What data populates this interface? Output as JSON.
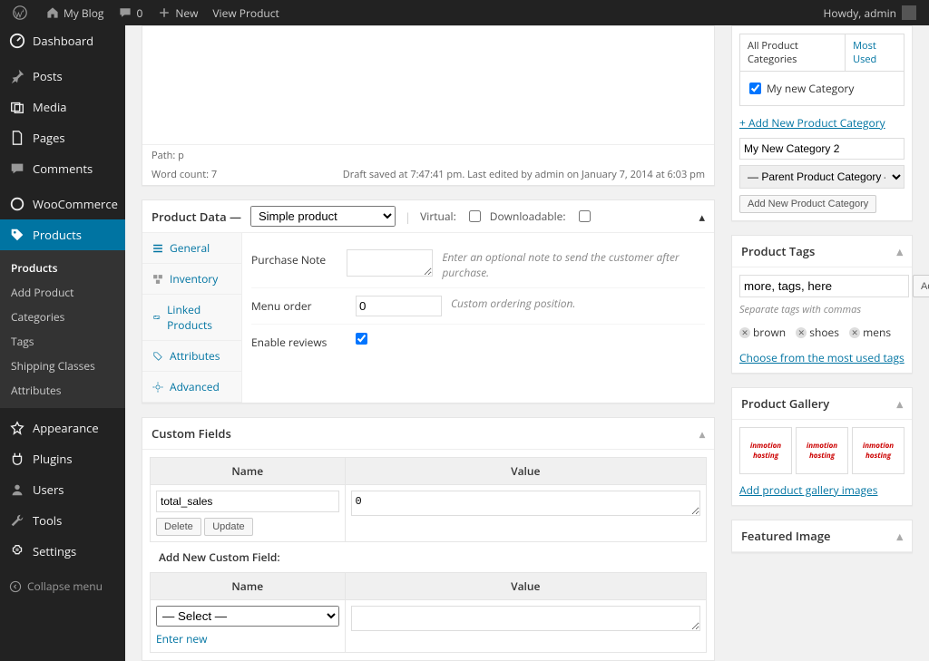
{
  "adminbar": {
    "site": "My Blog",
    "comments": "0",
    "new": "New",
    "view": "View Product",
    "howdy": "Howdy, admin"
  },
  "sidebar": {
    "items": [
      {
        "label": "Dashboard"
      },
      {
        "label": "Posts"
      },
      {
        "label": "Media"
      },
      {
        "label": "Pages"
      },
      {
        "label": "Comments"
      },
      {
        "label": "WooCommerce"
      },
      {
        "label": "Products"
      },
      {
        "label": "Appearance"
      },
      {
        "label": "Plugins"
      },
      {
        "label": "Users"
      },
      {
        "label": "Tools"
      },
      {
        "label": "Settings"
      }
    ],
    "submenu": [
      "Products",
      "Add Product",
      "Categories",
      "Tags",
      "Shipping Classes",
      "Attributes"
    ],
    "collapse": "Collapse menu"
  },
  "editor": {
    "path": "Path: p",
    "wordcount": "Word count: 7",
    "saved": "Draft saved at 7:47:41 pm. Last edited by admin on January 7, 2014 at 6:03 pm"
  },
  "product_data": {
    "title": "Product Data —",
    "type": "Simple product",
    "virtual": "Virtual:",
    "downloadable": "Downloadable:",
    "tabs": [
      "General",
      "Inventory",
      "Linked Products",
      "Attributes",
      "Advanced"
    ],
    "purchase_note": {
      "label": "Purchase Note",
      "desc": "Enter an optional note to send the customer after purchase."
    },
    "menu_order": {
      "label": "Menu order",
      "value": "0",
      "desc": "Custom ordering position."
    },
    "enable_reviews": {
      "label": "Enable reviews"
    }
  },
  "custom_fields": {
    "title": "Custom Fields",
    "name_header": "Name",
    "value_header": "Value",
    "row": {
      "name": "total_sales",
      "value": "0"
    },
    "delete": "Delete",
    "update": "Update",
    "add_new": "Add New Custom Field:",
    "select": "— Select —",
    "enter_new": "Enter new"
  },
  "categories": {
    "tabs": {
      "all": "All Product Categories",
      "most": "Most Used"
    },
    "item": "My new Category",
    "add_link": "+ Add New Product Category",
    "new_input": "My New Category 2",
    "parent": "— Parent Product Category —",
    "add_btn": "Add New Product Category"
  },
  "tags": {
    "title": "Product Tags",
    "input": "more, tags, here",
    "add": "Add",
    "hint": "Separate tags with commas",
    "items": [
      "brown",
      "shoes",
      "mens"
    ],
    "choose": "Choose from the most used tags"
  },
  "gallery": {
    "title": "Product Gallery",
    "thumb_text": "inmotion hosting",
    "add_link": "Add product gallery images"
  },
  "featured": {
    "title": "Featured Image"
  }
}
